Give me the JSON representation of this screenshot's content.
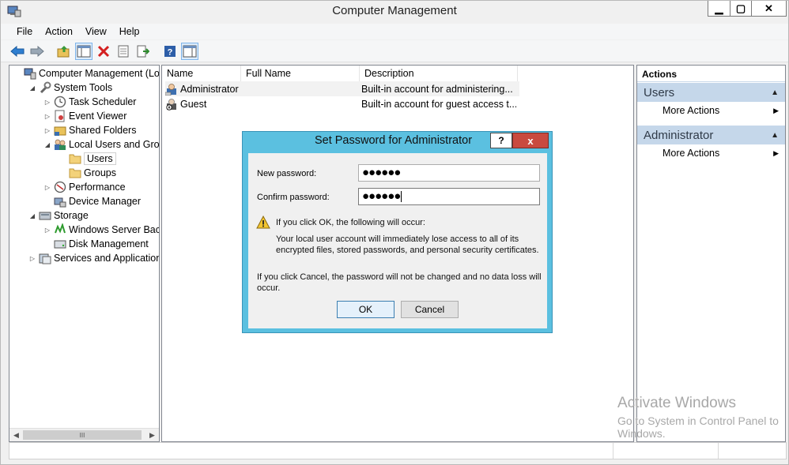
{
  "window": {
    "title": "Computer Management"
  },
  "menu": [
    "File",
    "Action",
    "View",
    "Help"
  ],
  "tree": [
    {
      "label": "Computer Management (Local",
      "level": 0,
      "arrow": "",
      "icon": "computer-management-icon"
    },
    {
      "label": "System Tools",
      "level": 1,
      "arrow": "expanded",
      "icon": "system-tools-icon"
    },
    {
      "label": "Task Scheduler",
      "level": 2,
      "arrow": "collapsed",
      "icon": "clock-icon"
    },
    {
      "label": "Event Viewer",
      "level": 2,
      "arrow": "collapsed",
      "icon": "event-viewer-icon"
    },
    {
      "label": "Shared Folders",
      "level": 2,
      "arrow": "collapsed",
      "icon": "shared-folder-icon"
    },
    {
      "label": "Local Users and Groups",
      "level": 2,
      "arrow": "expanded",
      "icon": "users-groups-icon"
    },
    {
      "label": "Users",
      "level": 3,
      "arrow": "",
      "icon": "folder-icon",
      "selected": true
    },
    {
      "label": "Groups",
      "level": 3,
      "arrow": "",
      "icon": "folder-icon"
    },
    {
      "label": "Performance",
      "level": 2,
      "arrow": "collapsed",
      "icon": "performance-icon"
    },
    {
      "label": "Device Manager",
      "level": 2,
      "arrow": "",
      "icon": "device-manager-icon"
    },
    {
      "label": "Storage",
      "level": 1,
      "arrow": "expanded",
      "icon": "storage-icon"
    },
    {
      "label": "Windows Server Backup",
      "level": 2,
      "arrow": "collapsed",
      "icon": "backup-icon"
    },
    {
      "label": "Disk Management",
      "level": 2,
      "arrow": "",
      "icon": "disk-icon"
    },
    {
      "label": "Services and Applications",
      "level": 1,
      "arrow": "collapsed",
      "icon": "services-icon"
    }
  ],
  "list": {
    "columns": [
      "Name",
      "Full Name",
      "Description"
    ],
    "rows": [
      {
        "name": "Administrator",
        "full_name": "",
        "description": "Built-in account for administering..."
      },
      {
        "name": "Guest",
        "full_name": "",
        "description": "Built-in account for guest access t..."
      }
    ]
  },
  "actions": {
    "title": "Actions",
    "sections": [
      {
        "header": "Users",
        "item": "More Actions"
      },
      {
        "header": "Administrator",
        "item": "More Actions"
      }
    ]
  },
  "dialog": {
    "title": "Set Password for Administrator",
    "help": "?",
    "close": "x",
    "new_password_label": "New password:",
    "new_password_value": "●●●●●●",
    "confirm_password_label": "Confirm password:",
    "confirm_password_value": "●●●●●●",
    "warning_heading": "If you click OK, the following will occur:",
    "warning_line1": "Your local user account will immediately lose access to all of its",
    "warning_line2": "encrypted files, stored passwords, and personal security certificates.",
    "cancel_line1": "If you click Cancel, the password will not be changed and no data loss will",
    "cancel_line2": "occur.",
    "ok": "OK",
    "cancel": "Cancel"
  },
  "watermark": {
    "line1": "Activate Windows",
    "line2": "Go to System in Control Panel to",
    "line3": "Windows."
  },
  "scrollbar_thumb": "III",
  "colors": {
    "dialog_frame": "#5bc0e0",
    "close_red": "#c94a3f",
    "actions_header": "#c5d7ea"
  }
}
